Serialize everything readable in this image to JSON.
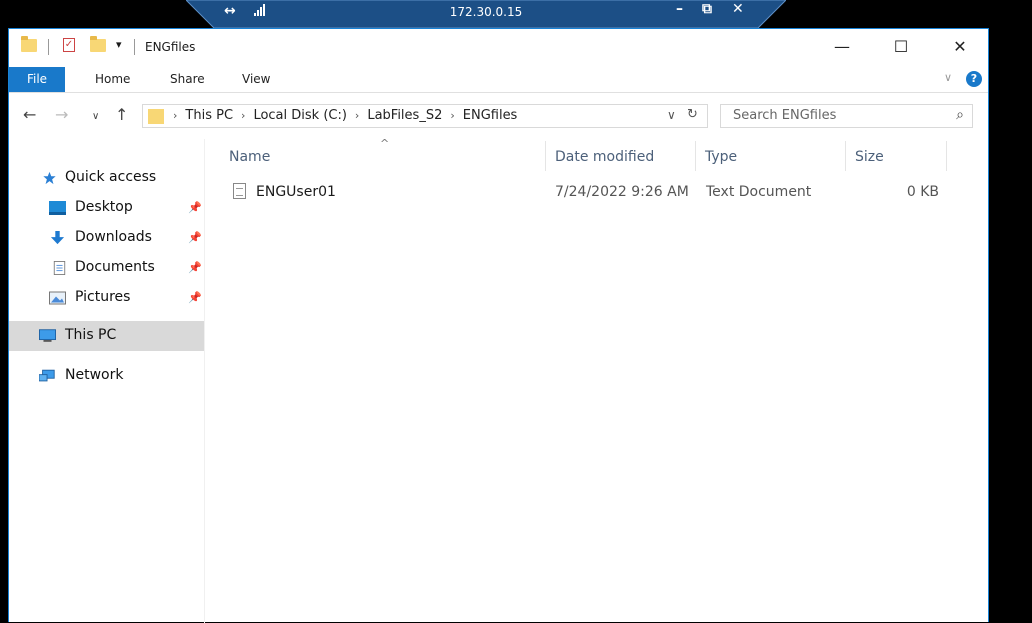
{
  "rdp": {
    "pin_glyph": "↔",
    "ip": "172.30.0.15",
    "minimize": "–",
    "restore": "⧉",
    "close": "✕"
  },
  "window": {
    "title": "ENGfiles",
    "qa_dropdown": "▾",
    "qa_check": "✓",
    "min": "—",
    "max": "☐",
    "close": "✕"
  },
  "ribbon": {
    "tabs": [
      "File",
      "Home",
      "Share",
      "View"
    ],
    "expand": "∨",
    "help": "?"
  },
  "nav": {
    "back": "←",
    "forward": "→",
    "recent": "∨",
    "up": "↑",
    "breadcrumb": [
      "This PC",
      "Local Disk (C:)",
      "LabFiles_S2",
      "ENGfiles"
    ],
    "crumb_sep": "›",
    "dropdown": "∨",
    "refresh": "↻",
    "search_placeholder": "Search ENGfiles",
    "search_glyph": "⌕"
  },
  "navpane": {
    "quick_access": "Quick access",
    "items": [
      {
        "label": "Desktop",
        "icon": "desktop-icon"
      },
      {
        "label": "Downloads",
        "icon": "downloads-icon"
      },
      {
        "label": "Documents",
        "icon": "documents-icon"
      },
      {
        "label": "Pictures",
        "icon": "pictures-icon"
      }
    ],
    "pin": "📌",
    "this_pc": "This PC",
    "network": "Network"
  },
  "files": {
    "sort_caret": "^",
    "columns": [
      "Name",
      "Date modified",
      "Type",
      "Size"
    ],
    "rows": [
      {
        "name": "ENGUser01",
        "date": "7/24/2022 9:26 AM",
        "type": "Text Document",
        "size": "0 KB"
      }
    ]
  },
  "colors": {
    "accent": "#1979ca",
    "rdp_bar": "#1c4f86",
    "selected": "#d9d9d9"
  }
}
